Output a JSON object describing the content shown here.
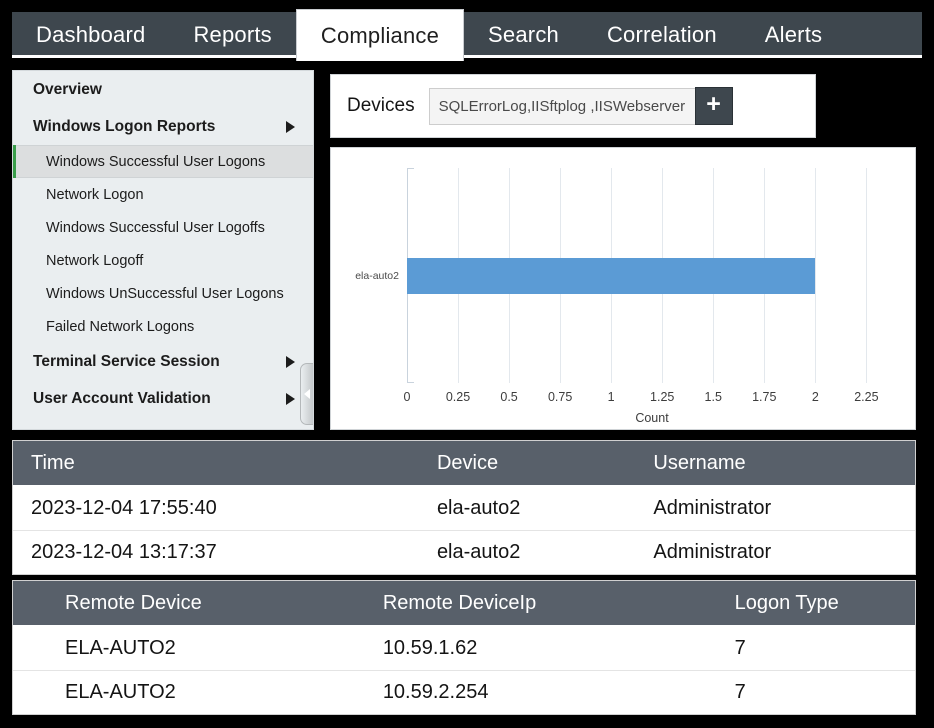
{
  "tabs": [
    {
      "label": "Dashboard",
      "active": false
    },
    {
      "label": "Reports",
      "active": false
    },
    {
      "label": "Compliance",
      "active": true
    },
    {
      "label": "Search",
      "active": false
    },
    {
      "label": "Correlation",
      "active": false
    },
    {
      "label": "Alerts",
      "active": false
    }
  ],
  "sidebar": {
    "items": [
      {
        "label": "Overview",
        "type": "group",
        "arrow": false,
        "selected": false
      },
      {
        "label": "Windows Logon Reports",
        "type": "group",
        "arrow": true,
        "selected": false
      },
      {
        "label": "Windows Successful User Logons",
        "type": "leaf",
        "arrow": false,
        "selected": true
      },
      {
        "label": "Network Logon",
        "type": "leaf",
        "arrow": false,
        "selected": false
      },
      {
        "label": "Windows Successful User Logoffs",
        "type": "leaf",
        "arrow": false,
        "selected": false
      },
      {
        "label": "Network Logoff",
        "type": "leaf",
        "arrow": false,
        "selected": false
      },
      {
        "label": "Windows UnSuccessful User Logons",
        "type": "leaf",
        "arrow": false,
        "selected": false
      },
      {
        "label": "Failed Network Logons",
        "type": "leaf",
        "arrow": false,
        "selected": false
      },
      {
        "label": "Terminal Service Session",
        "type": "group",
        "arrow": true,
        "selected": false
      },
      {
        "label": "User Account Validation",
        "type": "group",
        "arrow": true,
        "selected": false
      }
    ],
    "collapse_handle_icon": "chevron-left-icon"
  },
  "devices": {
    "label": "Devices",
    "value": "SQLErrorLog,IISftplog ,IISWebserver  ...",
    "placeholder": "SQLErrorLog,IISftplog ,IISWebserver  ...",
    "add_button_label": "+",
    "add_button_icon": "plus-icon"
  },
  "chart_data": {
    "type": "bar",
    "orientation": "horizontal",
    "categories": [
      "ela-auto2"
    ],
    "values": [
      2
    ],
    "title": "",
    "xlabel": "Count",
    "ylabel": "",
    "xlim": [
      0,
      2.4
    ],
    "xticks": [
      0,
      0.25,
      0.5,
      0.75,
      1,
      1.25,
      1.5,
      1.75,
      2,
      2.25
    ],
    "xtick_labels": [
      "0",
      "0.25",
      "0.5",
      "0.75",
      "1",
      "1.25",
      "1.5",
      "1.75",
      "2",
      "2.25"
    ],
    "grid": true,
    "legend": false,
    "bar_color": "#5b9bd5",
    "gridline_color": "#e3e8ed",
    "axis_color": "#c9d3dd"
  },
  "table_logons": {
    "columns": [
      "Time",
      "Device",
      "Username"
    ],
    "rows": [
      [
        "2023-12-04 17:55:40",
        "ela-auto2",
        "Administrator"
      ],
      [
        "2023-12-04 13:17:37",
        "ela-auto2",
        "Administrator"
      ]
    ]
  },
  "table_remote": {
    "columns": [
      "Remote Device",
      "Remote DeviceIp",
      "Logon Type"
    ],
    "rows": [
      [
        "ELA-AUTO2",
        "10.59.1.62",
        "7"
      ],
      [
        "ELA-AUTO2",
        "10.59.2.254",
        "7"
      ]
    ]
  },
  "colors": {
    "page_background": "#000000",
    "tabbar": "#3e474e",
    "tab_active": "#ffffff",
    "sidebar": "#eaeef0",
    "sidebar_selected": "#dcdedf",
    "sidebar_accent": "#3a9e4a",
    "table_header": "#58606a",
    "bar": "#5b9bd5"
  }
}
